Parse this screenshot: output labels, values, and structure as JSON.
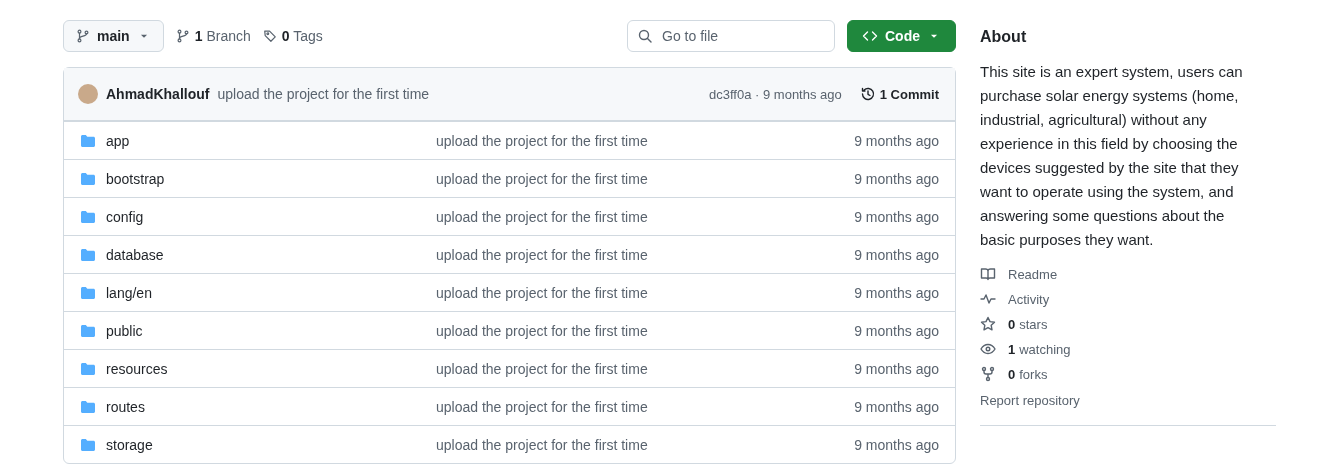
{
  "toolbar": {
    "branch": "main",
    "branches_count": "1",
    "branches_label": "Branch",
    "tags_count": "0",
    "tags_label": "Tags",
    "search": {
      "placeholder": "Go to file"
    },
    "code_button": "Code"
  },
  "latest_commit": {
    "author": "AhmadKhallouf",
    "message": "upload the project for the first time",
    "hash_and_time": "dc3ff0a · 9 months ago",
    "commits_count": "1",
    "commits_label": "Commit"
  },
  "files": [
    {
      "name": "app",
      "message": "upload the project for the first time",
      "time": "9 months ago"
    },
    {
      "name": "bootstrap",
      "message": "upload the project for the first time",
      "time": "9 months ago"
    },
    {
      "name": "config",
      "message": "upload the project for the first time",
      "time": "9 months ago"
    },
    {
      "name": "database",
      "message": "upload the project for the first time",
      "time": "9 months ago"
    },
    {
      "name": "lang/en",
      "message": "upload the project for the first time",
      "time": "9 months ago"
    },
    {
      "name": "public",
      "message": "upload the project for the first time",
      "time": "9 months ago"
    },
    {
      "name": "resources",
      "message": "upload the project for the first time",
      "time": "9 months ago"
    },
    {
      "name": "routes",
      "message": "upload the project for the first time",
      "time": "9 months ago"
    },
    {
      "name": "storage",
      "message": "upload the project for the first time",
      "time": "9 months ago"
    }
  ],
  "about": {
    "title": "About",
    "description": "This site is an expert system, users can purchase solar energy systems (home, industrial, agricultural) without any experience in this field by choosing the devices suggested by the site that they want to operate using the system, and answering some questions about the basic purposes they want.",
    "links": [
      {
        "kind": "readme",
        "label": "Readme"
      },
      {
        "kind": "activity",
        "label": "Activity"
      },
      {
        "kind": "stars",
        "count": "0",
        "label": "stars"
      },
      {
        "kind": "watching",
        "count": "1",
        "label": "watching"
      },
      {
        "kind": "forks",
        "count": "0",
        "label": "forks"
      }
    ],
    "report": "Report repository"
  }
}
